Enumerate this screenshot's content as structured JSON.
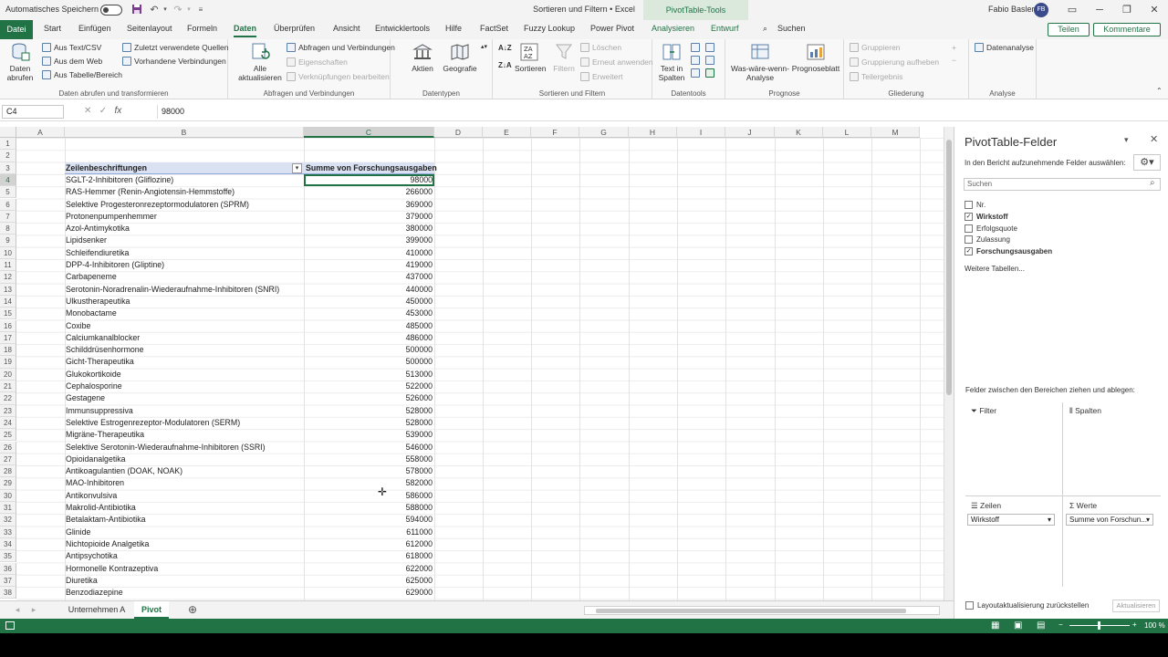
{
  "titlebar": {
    "autosave_label": "Automatisches Speichern",
    "doc_title": "Sortieren und Filtern  •  Excel",
    "contextual_tab": "PivotTable-Tools",
    "user_name": "Fabio Basler",
    "user_initials": "FB"
  },
  "tabs": {
    "file": "Datei",
    "items": [
      "Start",
      "Einfügen",
      "Seitenlayout",
      "Formeln",
      "Daten",
      "Überprüfen",
      "Ansicht",
      "Entwicklertools",
      "Hilfe",
      "FactSet",
      "Fuzzy Lookup",
      "Power Pivot",
      "Analysieren",
      "Entwurf"
    ],
    "search": "Suchen",
    "share": "Teilen",
    "comments": "Kommentare"
  },
  "ribbon": {
    "get_data": "Daten abrufen",
    "from_text": "Aus Text/CSV",
    "from_web": "Aus dem Web",
    "from_table": "Aus Tabelle/Bereich",
    "recent_sources": "Zuletzt verwendete Quellen",
    "existing_connections": "Vorhandene Verbindungen",
    "group_get_transform": "Daten abrufen und transformieren",
    "refresh_all": "Alle aktualisieren",
    "queries_connections": "Abfragen und Verbindungen",
    "properties": "Eigenschaften",
    "edit_links": "Verknüpfungen bearbeiten",
    "group_queries": "Abfragen und Verbindungen",
    "stocks": "Aktien",
    "geography": "Geografie",
    "group_datatypes": "Datentypen",
    "sort": "Sortieren",
    "filter": "Filtern",
    "clear": "Löschen",
    "reapply": "Erneut anwenden",
    "advanced": "Erweitert",
    "group_sort_filter": "Sortieren und Filtern",
    "text_to_columns": "Text in Spalten",
    "group_datatools": "Datentools",
    "what_if": "Was-wäre-wenn-Analyse",
    "forecast_sheet": "Prognoseblatt",
    "group_forecast": "Prognose",
    "group_btn": "Gruppieren",
    "ungroup_btn": "Gruppierung aufheben",
    "subtotal": "Teilergebnis",
    "group_outline": "Gliederung",
    "data_analysis": "Datenanalyse",
    "group_analysis": "Analyse"
  },
  "formula": {
    "namebox": "C4",
    "value": "98000"
  },
  "columns": [
    "A",
    "B",
    "C",
    "D",
    "E",
    "F",
    "G",
    "H",
    "I",
    "J",
    "K",
    "L",
    "M"
  ],
  "pivot": {
    "header_rows": "Zeilenbeschriftungen",
    "header_values": "Summe von Forschungsausgaben",
    "rows": [
      {
        "label": "SGLT-2-Inhibitoren (Gliflozine)",
        "value": "98000"
      },
      {
        "label": "RAS-Hemmer (Renin-Angiotensin-Hemmstoffe)",
        "value": "266000"
      },
      {
        "label": "Selektive Progesteronrezeptormodulatoren (SPRM)",
        "value": "369000"
      },
      {
        "label": "Protonenpumpenhemmer",
        "value": "379000"
      },
      {
        "label": "Azol-Antimykotika",
        "value": "380000"
      },
      {
        "label": "Lipidsenker",
        "value": "399000"
      },
      {
        "label": "Schleifendiuretika",
        "value": "410000"
      },
      {
        "label": "DPP-4-Inhibitoren (Gliptine)",
        "value": "419000"
      },
      {
        "label": "Carbapeneme",
        "value": "437000"
      },
      {
        "label": "Serotonin-Noradrenalin-Wiederaufnahme-Inhibitoren (SNRI)",
        "value": "440000"
      },
      {
        "label": "Ulkustherapeutika",
        "value": "450000"
      },
      {
        "label": "Monobactame",
        "value": "453000"
      },
      {
        "label": "Coxibe",
        "value": "485000"
      },
      {
        "label": "Calciumkanalblocker",
        "value": "486000"
      },
      {
        "label": "Schilddrüsenhormone",
        "value": "500000"
      },
      {
        "label": "Gicht-Therapeutika",
        "value": "500000"
      },
      {
        "label": "Glukokortikoide",
        "value": "513000"
      },
      {
        "label": "Cephalosporine",
        "value": "522000"
      },
      {
        "label": "Gestagene",
        "value": "526000"
      },
      {
        "label": "Immunsuppressiva",
        "value": "528000"
      },
      {
        "label": "Selektive Estrogenrezeptor-Modulatoren (SERM)",
        "value": "528000"
      },
      {
        "label": "Migräne-Therapeutika",
        "value": "539000"
      },
      {
        "label": "Selektive Serotonin-Wiederaufnahme-Inhibitoren (SSRI)",
        "value": "546000"
      },
      {
        "label": "Opioidanalgetika",
        "value": "558000"
      },
      {
        "label": "Antikoagulantien (DOAK, NOAK)",
        "value": "578000"
      },
      {
        "label": "MAO-Inhibitoren",
        "value": "582000"
      },
      {
        "label": "Antikonvulsiva",
        "value": "586000"
      },
      {
        "label": "Makrolid-Antibiotika",
        "value": "588000"
      },
      {
        "label": "Betalaktam-Antibiotika",
        "value": "594000"
      },
      {
        "label": "Glinide",
        "value": "611000"
      },
      {
        "label": "Nichtopioide Analgetika",
        "value": "612000"
      },
      {
        "label": "Antipsychotika",
        "value": "618000"
      },
      {
        "label": "Hormonelle Kontrazeptiva",
        "value": "622000"
      },
      {
        "label": "Diuretika",
        "value": "625000"
      },
      {
        "label": "Benzodiazepine",
        "value": "629000"
      }
    ]
  },
  "sheets": {
    "tabs": [
      "Unternehmen A",
      "Pivot"
    ],
    "active": "Pivot"
  },
  "status": {
    "zoom": "100 %"
  },
  "pane": {
    "title": "PivotTable-Felder",
    "subtitle": "In den Bericht aufzunehmende Felder auswählen:",
    "search_placeholder": "Suchen",
    "fields": [
      {
        "name": "Nr.",
        "checked": false
      },
      {
        "name": "Wirkstoff",
        "checked": true
      },
      {
        "name": "Erfolgsquote",
        "checked": false
      },
      {
        "name": "Zulassung",
        "checked": false
      },
      {
        "name": "Forschungsausgaben",
        "checked": true
      }
    ],
    "more_tables": "Weitere Tabellen...",
    "drag_hint": "Felder zwischen den Bereichen ziehen und ablegen:",
    "area_filter": "Filter",
    "area_columns": "Spalten",
    "area_rows": "Zeilen",
    "area_values": "Werte",
    "rows_item": "Wirkstoff",
    "values_item": "Summe von Forschun...",
    "defer_update": "Layoutaktualisierung zurückstellen",
    "update": "Aktualisieren"
  },
  "colors": {
    "accent": "#217346",
    "pivot_header": "#d9e1f2"
  }
}
